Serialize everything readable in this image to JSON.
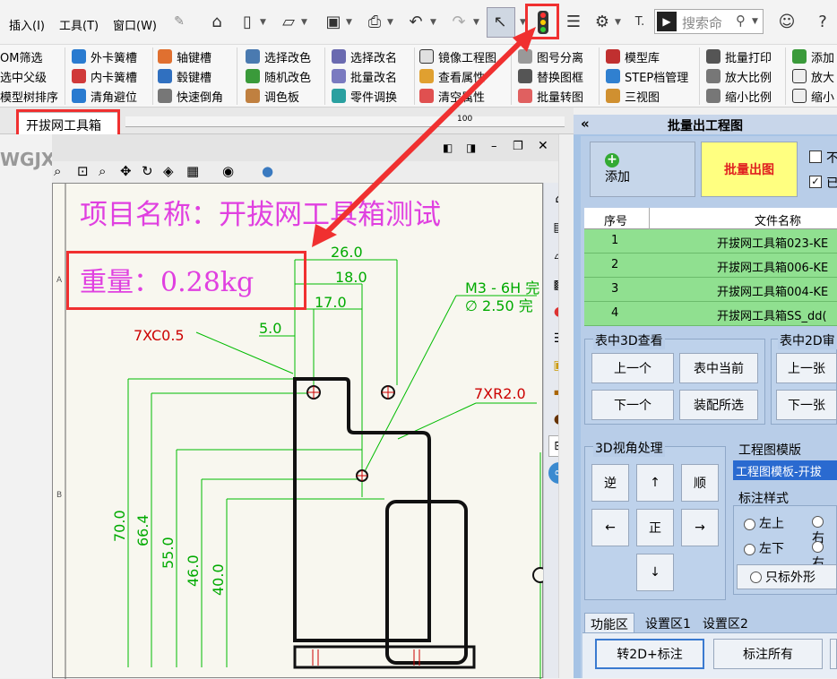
{
  "menubar": {
    "insert": "插入(I)",
    "tools": "工具(T)",
    "window": "窗口(W)",
    "search_placeholder": "搜索命"
  },
  "ribbon": {
    "col1": [
      "OM筛选",
      "选中父级",
      "模型树排序"
    ],
    "col2": [
      "外卡簧槽",
      "内卡簧槽",
      "清角避位"
    ],
    "col3": [
      "轴键槽",
      "毂键槽",
      "快速倒角"
    ],
    "col4": [
      "选择改色",
      "随机改色",
      "调色板"
    ],
    "col5": [
      "选择改名",
      "批量改名",
      "零件调换"
    ],
    "col6": [
      "镜像工程图",
      "查看属性",
      "清空属性"
    ],
    "col7": [
      "图号分离",
      "替换图框",
      "批量转图"
    ],
    "col8": [
      "模型库",
      "STEP档管理",
      "三视图"
    ],
    "col9": [
      "批量打印",
      "放大比例",
      "缩小比例"
    ],
    "col10": [
      "添加",
      "放大",
      "缩小"
    ]
  },
  "doc_tab": "开拔网工具箱",
  "left_text": "WGJX",
  "ruler_mark": "100",
  "drawing": {
    "project": "项目名称：开拔网工具箱测试",
    "weight": "重量：0.28kg",
    "dims": {
      "d26": "26.0",
      "d18": "18.0",
      "d17": "17.0",
      "d5": "5.0",
      "d70": "70.0",
      "d664": "66.4",
      "d55": "55.0",
      "d46": "46.0",
      "d40": "40.0"
    },
    "chamfer": "7XC0.5",
    "radius": "7XR2.0",
    "thread1": "M3 - 6H 完",
    "thread2": "∅ 2.50 完",
    "zone_a": "A",
    "zone_b": "B"
  },
  "panel": {
    "title": "批量出工程图",
    "collapse": "«",
    "add": "添加",
    "batch": "批量出图",
    "chk1": "不",
    "chk2": "已",
    "col_seq": "序号",
    "col_name": "文件名称",
    "rows": [
      {
        "n": "1",
        "name": "开拔网工具箱023-KE"
      },
      {
        "n": "2",
        "name": "开拔网工具箱006-KE"
      },
      {
        "n": "3",
        "name": "开拔网工具箱004-KE"
      },
      {
        "n": "4",
        "name": "开拔网工具箱SS_dd("
      }
    ],
    "g3d": "表中3D查看",
    "prev": "上一个",
    "cur": "表中当前",
    "next": "下一个",
    "asm": "装配所选",
    "g2d": "表中2D审",
    "prev2": "上一张",
    "next2": "下一张",
    "view3d": "3D视角处理",
    "ccw": "逆",
    "up": "↑",
    "cw": "顺",
    "left": "←",
    "front": "正",
    "right": "→",
    "down": "↓",
    "tpl_label": "工程图模版",
    "tpl_value": "工程图模板-开拔",
    "style_label": "标注样式",
    "tl": "左上",
    "bl": "左下",
    "tr": "右",
    "br": "右",
    "outline": "只标外形",
    "tabs": [
      "功能区",
      "设置区1",
      "设置区2"
    ],
    "to2d": "转2D+标注",
    "markall": "标注所有"
  }
}
